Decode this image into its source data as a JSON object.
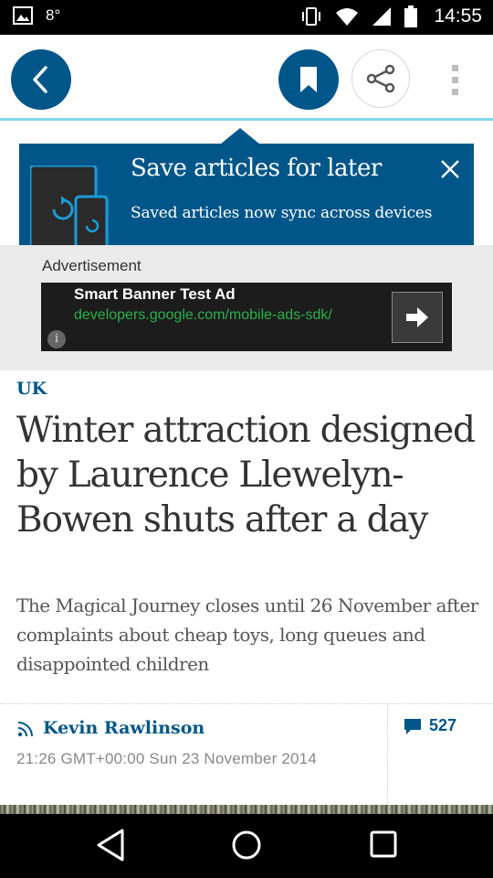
{
  "status_bar": {
    "time": "14:55",
    "temperature": "8°",
    "icons": [
      "image-notification-icon",
      "vibrate-icon",
      "wifi-icon",
      "signal-icon",
      "battery-icon"
    ]
  },
  "toolbar": {
    "back_icon": "chevron-left-icon",
    "save_icon": "bookmark-icon",
    "share_icon": "share-icon",
    "more_icon": "more-vertical-icon"
  },
  "save_banner": {
    "title": "Save articles for later",
    "subtitle": "Saved articles now sync across devices",
    "close_icon": "close-icon"
  },
  "advertisement": {
    "label": "Advertisement",
    "title": "Smart Banner Test Ad",
    "url": "developers.google.com/mobile-ads-sdk/",
    "info_glyph": "i"
  },
  "article": {
    "section": "UK",
    "headline": "Winter attraction designed by Laurence Llewelyn-Bowen shuts after a day",
    "standfirst": "The Magical Journey closes until 26 November after complaints about cheap toys, long queues and disappointed children",
    "byline": "Kevin Rawlinson",
    "dateline": "21:26 GMT+00:00 Sun 23 November 2014",
    "comment_count": "527"
  },
  "colors": {
    "brand_blue": "#005689",
    "accent_light_blue": "#80d4ec",
    "ad_link_green": "#29b34b"
  }
}
